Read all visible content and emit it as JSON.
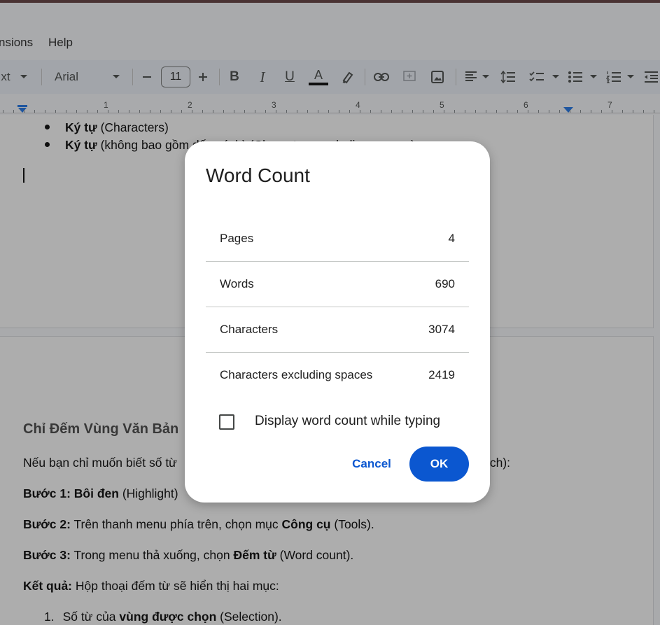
{
  "menu": {
    "items": [
      {
        "label": "nsions"
      },
      {
        "label": "Help"
      }
    ]
  },
  "toolbar": {
    "style_fragment": "xt",
    "font_name": "Arial",
    "font_size": "11",
    "icons": [
      "dropdown-icon",
      "minus-icon",
      "plus-icon",
      "bold-icon",
      "italic-icon",
      "underline-icon",
      "text-color-icon",
      "highlight-icon",
      "link-icon",
      "comment-icon",
      "image-icon",
      "align-icon",
      "line-spacing-icon",
      "checklist-icon",
      "bulleted-list-icon",
      "numbered-list-icon",
      "indent-icon"
    ],
    "bold_label": "B",
    "italic_label": "I",
    "underline_label": "U",
    "text_color_label": "A"
  },
  "ruler": {
    "numbers": [
      "1",
      "2",
      "3",
      "4",
      "5",
      "6",
      "7"
    ]
  },
  "document": {
    "page1": {
      "bullets": [
        {
          "bold": "Ký tự",
          "text": " (Characters)"
        },
        {
          "bold": "Ký tự",
          "text": " (không bao gồm dấu cách) (Characters excluding spaces)"
        }
      ]
    },
    "page2": {
      "heading": "Chỉ Đếm Vùng Văn Bản",
      "para1": "Nếu bạn chỉ muốn biết số từ",
      "para1_tail": "ích):",
      "step1_bold": "Bước 1:",
      "step1_bold2": " Bôi đen",
      "step1_text": " (Highlight) ",
      "step2_bold": "Bước 2:",
      "step2_text": " Trên thanh menu phía trên, chọn mục ",
      "step2_bold2": "Công cụ",
      "step2_tail": " (Tools).",
      "step3_bold": "Bước 3:",
      "step3_text": " Trong menu thả xuống, chọn ",
      "step3_bold2": "Đếm từ",
      "step3_tail": " (Word count).",
      "result_bold": "Kết quả:",
      "result_text": " Hộp thoại đếm từ sẽ hiển thị hai mục:",
      "list1_num": "1.",
      "list1_text": "Số từ của ",
      "list1_bold": "vùng được chọn",
      "list1_tail": " (Selection)."
    }
  },
  "dialog": {
    "title": "Word Count",
    "rows": [
      {
        "label": "Pages",
        "value": "4"
      },
      {
        "label": "Words",
        "value": "690"
      },
      {
        "label": "Characters",
        "value": "3074"
      },
      {
        "label": "Characters excluding spaces",
        "value": "2419"
      }
    ],
    "checkbox_label": "Display word count while typing",
    "checkbox_checked": false,
    "cancel_label": "Cancel",
    "ok_label": "OK"
  },
  "colors": {
    "accent": "#0b57d0",
    "scrim": "rgba(40,40,40,0.38)",
    "toolbar_bg": "#edf2fa"
  }
}
